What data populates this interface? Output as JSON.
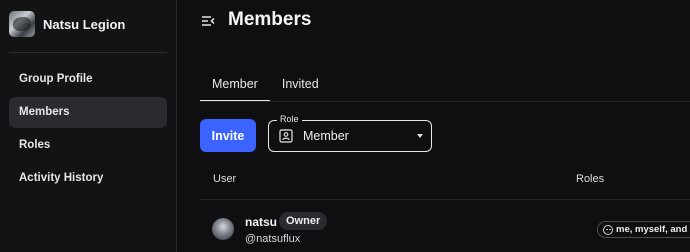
{
  "sidebar": {
    "group_name": "Natsu Legion",
    "nav": [
      {
        "label": "Group Profile",
        "active": false
      },
      {
        "label": "Members",
        "active": true
      },
      {
        "label": "Roles",
        "active": false
      },
      {
        "label": "Activity History",
        "active": false
      }
    ]
  },
  "header": {
    "title": "Members",
    "collapse_icon": "sidebar-collapse-icon"
  },
  "tabs": [
    {
      "label": "Member",
      "active": true
    },
    {
      "label": "Invited",
      "active": false
    }
  ],
  "toolbar": {
    "invite_label": "Invite",
    "role_filter": {
      "legend": "Role",
      "value": "Member",
      "icon": "id-card-icon"
    }
  },
  "table": {
    "columns": [
      "User",
      "Roles"
    ],
    "rows": [
      {
        "display_name": "natsu",
        "badge": "Owner",
        "handle": "@natsuflux",
        "role": "me, myself, and i",
        "role_icon": "emoji-face-icon"
      }
    ]
  },
  "colors": {
    "background": "#0f0f12",
    "sidebar": "#131316",
    "accent": "#3a63ff",
    "active_nav": "#2a2a30"
  }
}
